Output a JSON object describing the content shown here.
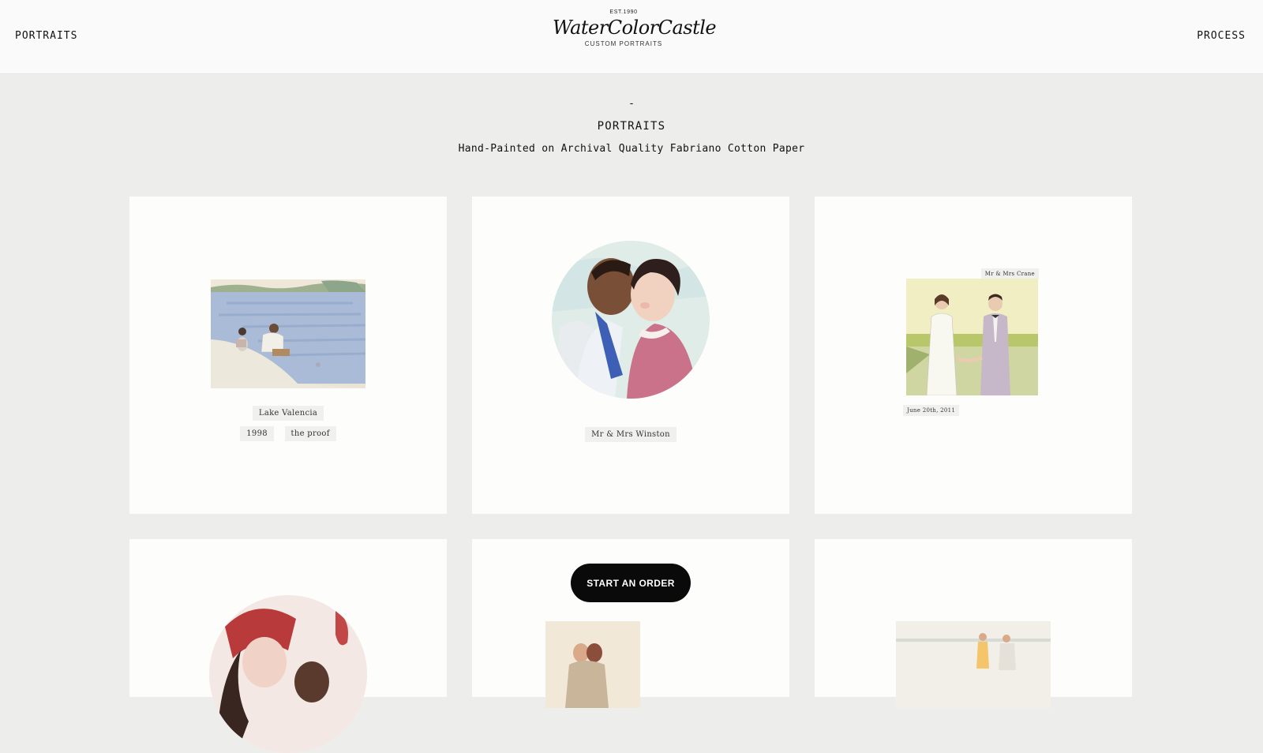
{
  "nav": {
    "left_label": "PORTRAITS",
    "right_label": "PROCESS"
  },
  "logo": {
    "est": "EST.1990",
    "name": "WaterColorCastle",
    "tagline": "CUSTOM PORTRAITS"
  },
  "heading": {
    "dash": "-",
    "title": "PORTRAITS",
    "subtitle": "Hand-Painted on Archival Quality Fabriano Cotton Paper"
  },
  "cards": [
    {
      "tags": [
        "Lake Valencia",
        "1998",
        "the proof"
      ]
    },
    {
      "tags": [
        "Mr & Mrs Winston"
      ]
    },
    {
      "tags": [
        "Mr & Mrs Crane",
        "June 20th, 2011"
      ]
    }
  ],
  "cta": {
    "label": "START AN ORDER"
  },
  "colors": {
    "background": "#ededec",
    "header": "#fafafa",
    "card": "#fdfdfc",
    "button": "#0a0a0a"
  }
}
